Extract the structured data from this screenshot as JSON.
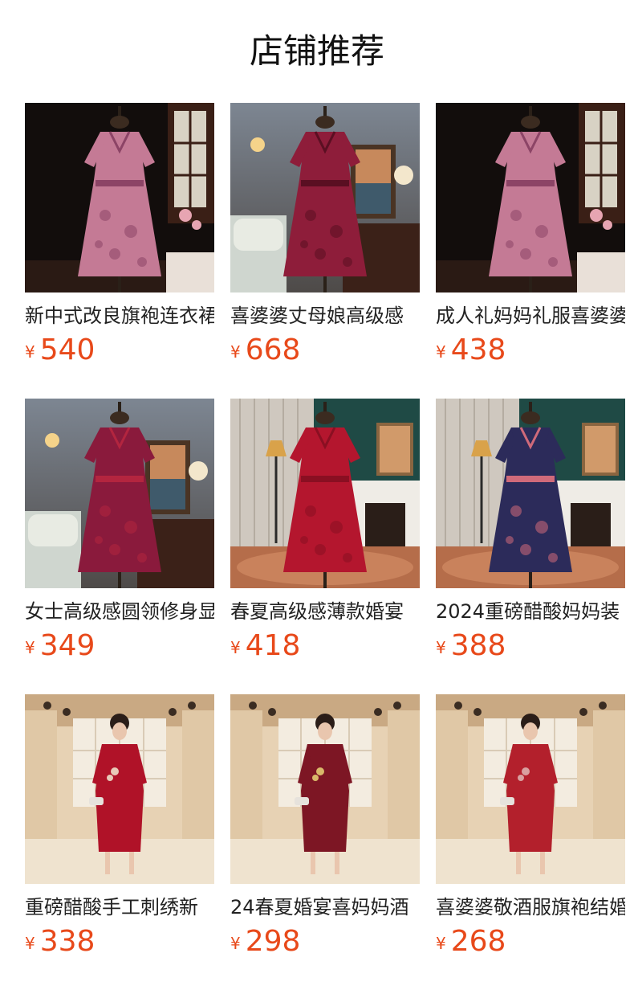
{
  "header": {
    "title": "店铺推荐"
  },
  "products": [
    {
      "name": "新中式改良旗袍连衣裙",
      "currency": "¥",
      "price": "540",
      "image": "dress-photo",
      "scene": "dark",
      "dress": "#c47a95",
      "accent": "#8c4466"
    },
    {
      "name": "喜婆婆丈母娘高级感",
      "currency": "¥",
      "price": "668",
      "image": "dress-photo",
      "scene": "room",
      "dress": "#8e1d3a",
      "accent": "#5a0f22"
    },
    {
      "name": "成人礼妈妈礼服喜婆婆",
      "currency": "¥",
      "price": "438",
      "image": "dress-photo",
      "scene": "dark",
      "dress": "#c47a95",
      "accent": "#8c4466"
    },
    {
      "name": "女士高级感圆领修身显",
      "currency": "¥",
      "price": "349",
      "image": "dress-photo",
      "scene": "room",
      "dress": "#8a1a3c",
      "accent": "#b3253f"
    },
    {
      "name": "春夏高级感薄款婚宴",
      "currency": "¥",
      "price": "418",
      "image": "dress-photo",
      "scene": "green",
      "dress": "#b4162e",
      "accent": "#8a0f22"
    },
    {
      "name": "2024重磅醋酸妈妈装",
      "currency": "¥",
      "price": "388",
      "image": "dress-photo",
      "scene": "green",
      "dress": "#2c2b5a",
      "accent": "#d06a7a"
    },
    {
      "name": "重磅醋酸手工刺绣新",
      "currency": "¥",
      "price": "338",
      "image": "model-photo",
      "scene": "hall",
      "dress": "#b01228",
      "accent": "#e8c9b8"
    },
    {
      "name": "24春夏婚宴喜妈妈酒",
      "currency": "¥",
      "price": "298",
      "image": "model-photo",
      "scene": "hall",
      "dress": "#7d1624",
      "accent": "#d9b86a"
    },
    {
      "name": "喜婆婆敬酒服旗袍结婚",
      "currency": "¥",
      "price": "268",
      "image": "model-photo",
      "scene": "hall",
      "dress": "#b3202c",
      "accent": "#d9a0a0"
    }
  ]
}
